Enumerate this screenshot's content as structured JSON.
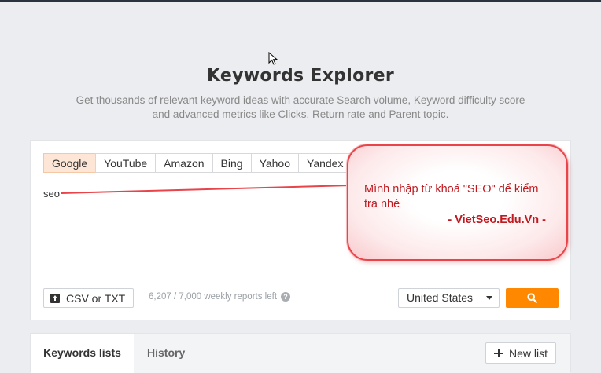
{
  "header": {
    "title": "Keywords Explorer",
    "subtitle": "Get thousands of relevant keyword ideas with accurate Search volume, Keyword difficulty score and advanced metrics like Clicks, Return rate and Parent topic."
  },
  "search_engines": {
    "tabs": [
      "Google",
      "YouTube",
      "Amazon",
      "Bing",
      "Yahoo",
      "Yandex"
    ],
    "selected": "Google"
  },
  "keywords_input": {
    "value": "seo"
  },
  "toolbar": {
    "csv_label": "CSV or TXT",
    "reports_text": "6,207 / 7,000 weekly reports left",
    "country": "United States"
  },
  "lists_panel": {
    "tab_keywords_lists": "Keywords lists",
    "tab_history": "History",
    "new_list_label": "New list"
  },
  "annotation": {
    "message": "Mình nhập từ khoá \"SEO\" để kiểm tra nhé",
    "signature": "- VietSeo.Edu.Vn -"
  },
  "colors": {
    "accent": "#ff8800",
    "selected_tab_bg": "#fde6d6",
    "callout_border": "#e8444a",
    "callout_text": "#c0191f"
  },
  "icons": [
    "mouse-cursor-icon",
    "upload-icon",
    "help-icon",
    "caret-down-icon",
    "search-icon",
    "plus-icon"
  ]
}
